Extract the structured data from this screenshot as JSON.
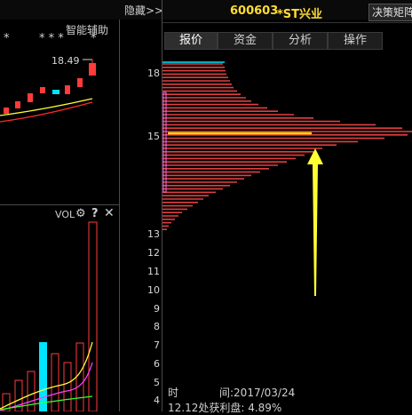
{
  "header": {
    "hide_label": "隐藏>>",
    "stock_code": "600603",
    "stock_name": "*ST兴业",
    "decision_label": "决策矩阵"
  },
  "left_panel": {
    "assist_label": "智能辅助",
    "price_marker": "18.49",
    "stars_left": "*",
    "stars_right": "* * *",
    "vol_label": "VOL"
  },
  "tabs": [
    {
      "label": "报价",
      "active": true
    },
    {
      "label": "资金",
      "active": false
    },
    {
      "label": "分析",
      "active": false
    },
    {
      "label": "操作",
      "active": false
    }
  ],
  "y_axis": {
    "upper_ticks": [
      "18",
      "15"
    ],
    "lower_ticks": [
      "13",
      "12",
      "11",
      "10",
      "9",
      "8",
      "7",
      "6",
      "5",
      "4"
    ]
  },
  "footer": {
    "time_label": "时",
    "date_label": "间:2017/03/24",
    "profit_label": "12.12处获利盘: 4.89%"
  },
  "colors": {
    "profile_bar": "#e04040",
    "avg_line": "#ffd800",
    "arrow": "#ffff33",
    "up_candle": "#ff3b3b",
    "cyan": "#00e5ff"
  },
  "icons": [
    "gear-icon",
    "help-icon",
    "close-icon",
    "arrow-up-icon"
  ]
}
